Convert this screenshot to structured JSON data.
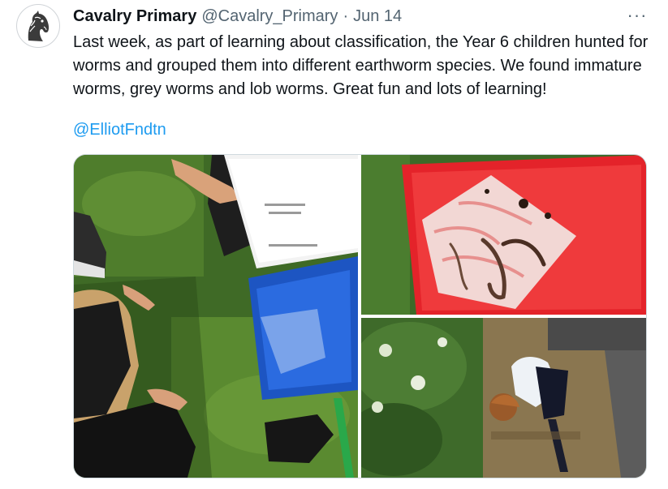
{
  "tweet": {
    "author_name": "Cavalry Primary",
    "author_handle": "@Cavalry_Primary",
    "separator": "·",
    "date": "Jun 14",
    "more_glyph": "···",
    "text": "Last week, as part of learning about classification, the Year 6 children hunted for worms and grouped them into different earthworm species. We found immature worms, grey worms and lob worms. Great fun and lots of learning!",
    "mention": "@ElliotFndtn"
  },
  "icons": {
    "more": "more-options-icon",
    "avatar": "horse-logo"
  },
  "colors": {
    "text": "#0f1419",
    "secondary": "#536471",
    "link": "#1d9bf0",
    "border": "#cfd9de"
  },
  "media": {
    "count": 3
  }
}
